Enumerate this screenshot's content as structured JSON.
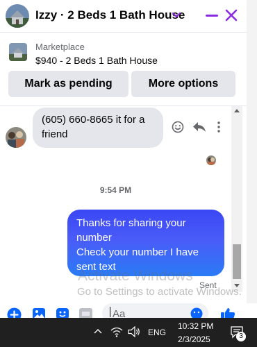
{
  "header": {
    "title": "Izzy · 2 Beds 1 Bath House"
  },
  "listing": {
    "label": "Marketplace",
    "price_title": "$940 - 2 Beds 1 Bath House",
    "mark_pending": "Mark as pending",
    "more_options": "More options"
  },
  "thread": {
    "incoming_message": "(605) 660-8665 it for a friend",
    "timestamp": "9:54 PM",
    "outgoing_message_line1": "Thanks for sharing your number",
    "outgoing_message_line2": "Check your number I have sent text",
    "sent_status": "Sent"
  },
  "watermark": {
    "line1": "Activate Windows",
    "line2": "Go to Settings to activate Windows."
  },
  "composer": {
    "placeholder": "Aa"
  },
  "taskbar": {
    "language": "ENG",
    "time": "10:32 PM",
    "date": "2/3/2025",
    "notification_count": "3"
  },
  "colors": {
    "accent": "#8a2be2",
    "messenger_blue": "#0866ff",
    "bubble_gradient_top": "#3a47f5",
    "bubble_gradient_bottom": "#2a7bf6"
  },
  "icons": [
    "chevron-down-icon",
    "minimize-icon",
    "close-icon",
    "emoji-icon",
    "reply-icon",
    "more-icon",
    "plus-icon",
    "photo-icon",
    "sticker-icon",
    "gif-icon",
    "like-icon",
    "chevron-up-icon",
    "wifi-icon",
    "volume-icon",
    "notification-icon"
  ]
}
